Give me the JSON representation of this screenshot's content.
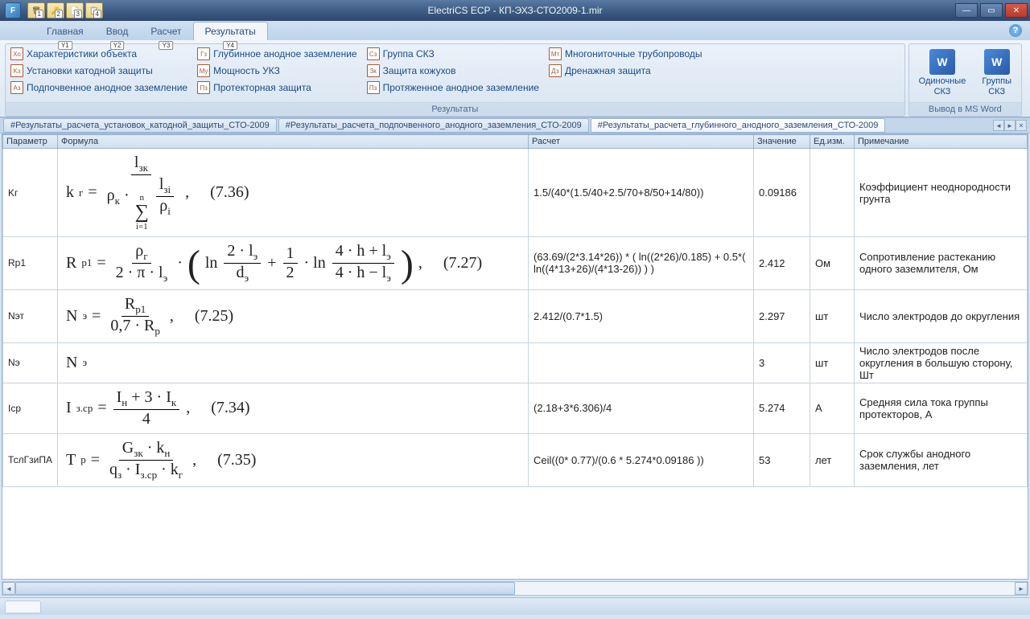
{
  "app": {
    "icon_letter": "F",
    "title": "ElectriCS ECP - КП-ЭХЗ-СТО2009-1.mir"
  },
  "qat": [
    {
      "num": "1"
    },
    {
      "num": "2"
    },
    {
      "num": "3"
    },
    {
      "num": "4"
    }
  ],
  "ribbon_tabs": [
    {
      "label": "Главная",
      "key": "Y1"
    },
    {
      "label": "Ввод",
      "key": "Y2"
    },
    {
      "label": "Расчет",
      "key": "Y3"
    },
    {
      "label": "Результаты",
      "key": "Y4",
      "active": true
    }
  ],
  "ribbon": {
    "group_results": {
      "label": "Результаты",
      "col1": [
        {
          "icon": "Xo",
          "label": "Характеристики объекта"
        },
        {
          "icon": "Kз",
          "label": "Установки катодной защиты"
        },
        {
          "icon": "Aз",
          "label": "Подпочвенное анодное заземление"
        }
      ],
      "col2": [
        {
          "icon": "Гз",
          "label": "Глубинное анодное заземление"
        },
        {
          "icon": "Mу",
          "label": "Мощность УКЗ"
        },
        {
          "icon": "Пз",
          "label": "Протекторная защита"
        }
      ],
      "col3": [
        {
          "icon": "Сз",
          "label": "Группа СКЗ"
        },
        {
          "icon": "Зк",
          "label": "Защита кожухов"
        },
        {
          "icon": "Пз",
          "label": "Протяженное анодное заземление"
        }
      ],
      "col4": [
        {
          "icon": "Mт",
          "label": "Многониточные трубопроводы"
        },
        {
          "icon": "Дз",
          "label": "Дренажная защита"
        }
      ]
    },
    "group_word": {
      "label": "Вывод в MS Word",
      "items": [
        {
          "label": "Одиночные\nСКЗ"
        },
        {
          "label": "Группы\nСКЗ"
        }
      ]
    }
  },
  "doc_tabs": [
    {
      "label": "#Результаты_расчета_установок_катодной_защиты_СТО-2009"
    },
    {
      "label": "#Результаты_расчета_подпочвенного_анодного_заземления_СТО-2009"
    },
    {
      "label": "#Результаты_расчета_глубинного_анодного_заземления_СТО-2009",
      "active": true
    }
  ],
  "columns": [
    "Параметр",
    "Формула",
    "Расчет",
    "Значение",
    "Ед.изм.",
    "Примечание"
  ],
  "rows": [
    {
      "param": "Kг",
      "formula_id": "f_kg",
      "eqnum": "(7.36)",
      "calc": "1.5/(40*(1.5/40+2.5/70+8/50+14/80))",
      "value": "0.09186",
      "unit": "",
      "note": "Коэффициент неоднородности грунта"
    },
    {
      "param": "Rp1",
      "formula_id": "f_rp1",
      "eqnum": "(7.27)",
      "calc": "(63.69/(2*3.14*26))  *  (   ln((2*26)/0.185)   + 0.5*(  ln((4*13+26)/(4*13-26)) )  )",
      "value": "2.412",
      "unit": "Ом",
      "note": "Сопротивление растеканию одного заземлителя, Ом"
    },
    {
      "param": "Nэт",
      "formula_id": "f_net",
      "eqnum": "(7.25)",
      "calc": "2.412/(0.7*1.5)",
      "value": "2.297",
      "unit": "шт",
      "note": "Число электродов до округления"
    },
    {
      "param": "Nэ",
      "formula_id": "f_ne",
      "eqnum": "",
      "calc": "",
      "value": "3",
      "unit": "шт",
      "note": "Число электродов после округления в большую сторону, Шт"
    },
    {
      "param": "Iср",
      "formula_id": "f_icr",
      "eqnum": "(7.34)",
      "calc": "(2.18+3*6.306)/4",
      "value": "5.274",
      "unit": "А",
      "note": "Средняя сила тока группы протекторов, А"
    },
    {
      "param": "ТслГзиПА",
      "formula_id": "f_tp",
      "eqnum": "(7.35)",
      "calc": "Ceil((0* 0.77)/(0.6 * 5.274*0.09186 ))",
      "value": "53",
      "unit": "лет",
      "note": "Срок службы анодного заземления, лет"
    }
  ]
}
